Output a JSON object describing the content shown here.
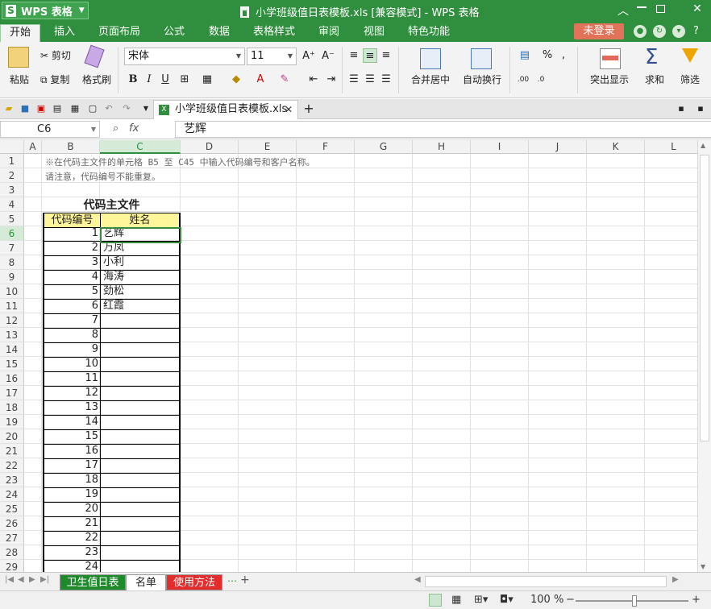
{
  "titlebar": {
    "app_name": "WPS 表格",
    "logo_glyph": "S",
    "doc_title": "小学班级值日表模板.xls [兼容模式] - WPS 表格"
  },
  "menu": {
    "tabs": [
      "开始",
      "插入",
      "页面布局",
      "公式",
      "数据",
      "表格样式",
      "审阅",
      "视图",
      "特色功能"
    ],
    "active_tab": "开始",
    "login_label": "未登录"
  },
  "ribbon": {
    "paste": "粘贴",
    "cut": "剪切",
    "copy": "复制",
    "format_painter": "格式刷",
    "font_name": "宋体",
    "font_size": "11",
    "merge_center": "合并居中",
    "wrap_text": "自动换行",
    "highlight": "突出显示",
    "sum": "求和",
    "filter": "筛选"
  },
  "doc_tab": {
    "label": "小学班级值日表模板.xls"
  },
  "formula_bar": {
    "cell_ref": "C6",
    "fx_label": "fx",
    "value": "艺辉"
  },
  "sheet": {
    "columns": [
      "A",
      "B",
      "C",
      "D",
      "E",
      "F",
      "G",
      "H",
      "I",
      "J",
      "K",
      "L"
    ],
    "selected_column": "C",
    "selected_row": 6,
    "note_line1": "※在代码主文件的单元格 B5 至 C45 中输入代码编号和客户名称。",
    "note_line2": "请注意，代码编号不能重复。",
    "table_title": "代码主文件",
    "header_code": "代码编号",
    "header_name": "姓名",
    "rows": [
      {
        "code": "1",
        "name": "艺辉"
      },
      {
        "code": "2",
        "name": "万凤"
      },
      {
        "code": "3",
        "name": "小利"
      },
      {
        "code": "4",
        "name": "海涛"
      },
      {
        "code": "5",
        "name": "劲松"
      },
      {
        "code": "6",
        "name": "红霞"
      },
      {
        "code": "7",
        "name": ""
      },
      {
        "code": "8",
        "name": ""
      },
      {
        "code": "9",
        "name": ""
      },
      {
        "code": "10",
        "name": ""
      },
      {
        "code": "11",
        "name": ""
      },
      {
        "code": "12",
        "name": ""
      },
      {
        "code": "13",
        "name": ""
      },
      {
        "code": "14",
        "name": ""
      },
      {
        "code": "15",
        "name": ""
      },
      {
        "code": "16",
        "name": ""
      },
      {
        "code": "17",
        "name": ""
      },
      {
        "code": "18",
        "name": ""
      },
      {
        "code": "19",
        "name": ""
      },
      {
        "code": "20",
        "name": ""
      },
      {
        "code": "21",
        "name": ""
      },
      {
        "code": "22",
        "name": ""
      },
      {
        "code": "23",
        "name": ""
      },
      {
        "code": "24",
        "name": ""
      }
    ]
  },
  "sheet_tabs": [
    {
      "label": "卫生值日表",
      "bg": "#1f8a2c",
      "fg": "#ffffff"
    },
    {
      "label": "名单",
      "bg": "#ffffff",
      "fg": "#222222"
    },
    {
      "label": "使用方法",
      "bg": "#e32c2c",
      "fg": "#ffffff"
    }
  ],
  "status": {
    "zoom": "100 %"
  },
  "colors": {
    "brand_green": "#2f8f3e",
    "header_yellow": "#fff59b",
    "login_red": "#e1735a"
  }
}
